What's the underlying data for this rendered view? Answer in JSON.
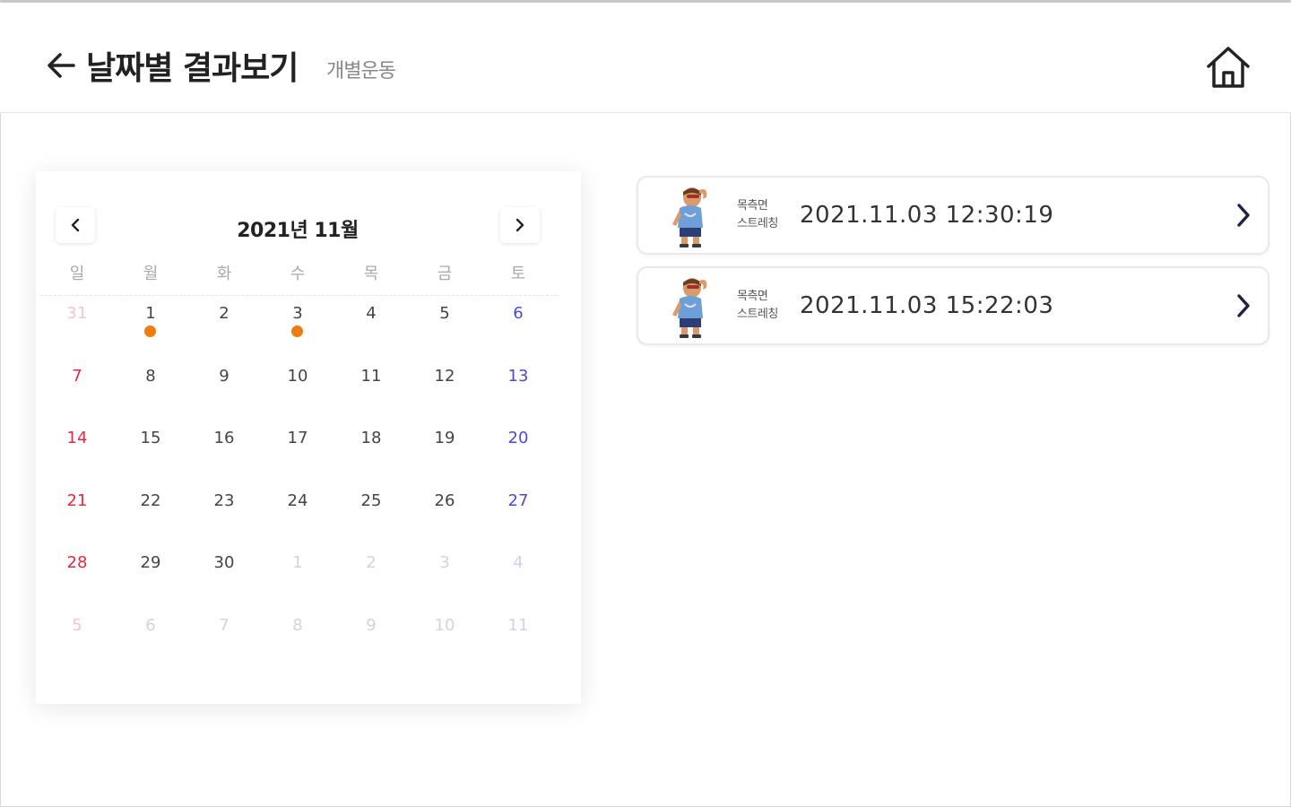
{
  "header": {
    "title": "날짜별 결과보기",
    "subtitle": "개별운동",
    "back_icon": "arrow-left-icon",
    "home_icon": "home-icon"
  },
  "calendar": {
    "month_label": "2021년 11월",
    "prev_icon": "chevron-left-icon",
    "next_icon": "chevron-right-icon",
    "weekdays": [
      "일",
      "월",
      "화",
      "수",
      "목",
      "금",
      "토"
    ],
    "days": [
      {
        "label": "31",
        "other": true,
        "dot": false
      },
      {
        "label": "1",
        "other": false,
        "dot": true
      },
      {
        "label": "2",
        "other": false,
        "dot": false
      },
      {
        "label": "3",
        "other": false,
        "dot": true
      },
      {
        "label": "4",
        "other": false,
        "dot": false
      },
      {
        "label": "5",
        "other": false,
        "dot": false
      },
      {
        "label": "6",
        "other": false,
        "dot": false
      },
      {
        "label": "7",
        "other": false,
        "dot": false
      },
      {
        "label": "8",
        "other": false,
        "dot": false
      },
      {
        "label": "9",
        "other": false,
        "dot": false
      },
      {
        "label": "10",
        "other": false,
        "dot": false
      },
      {
        "label": "11",
        "other": false,
        "dot": false
      },
      {
        "label": "12",
        "other": false,
        "dot": false
      },
      {
        "label": "13",
        "other": false,
        "dot": false
      },
      {
        "label": "14",
        "other": false,
        "dot": false
      },
      {
        "label": "15",
        "other": false,
        "dot": false
      },
      {
        "label": "16",
        "other": false,
        "dot": false
      },
      {
        "label": "17",
        "other": false,
        "dot": false
      },
      {
        "label": "18",
        "other": false,
        "dot": false
      },
      {
        "label": "19",
        "other": false,
        "dot": false
      },
      {
        "label": "20",
        "other": false,
        "dot": false
      },
      {
        "label": "21",
        "other": false,
        "dot": false
      },
      {
        "label": "22",
        "other": false,
        "dot": false
      },
      {
        "label": "23",
        "other": false,
        "dot": false
      },
      {
        "label": "24",
        "other": false,
        "dot": false
      },
      {
        "label": "25",
        "other": false,
        "dot": false
      },
      {
        "label": "26",
        "other": false,
        "dot": false
      },
      {
        "label": "27",
        "other": false,
        "dot": false
      },
      {
        "label": "28",
        "other": false,
        "dot": false
      },
      {
        "label": "29",
        "other": false,
        "dot": false
      },
      {
        "label": "30",
        "other": false,
        "dot": false
      },
      {
        "label": "1",
        "other": true,
        "dot": false
      },
      {
        "label": "2",
        "other": true,
        "dot": false
      },
      {
        "label": "3",
        "other": true,
        "dot": false
      },
      {
        "label": "4",
        "other": true,
        "dot": false
      },
      {
        "label": "5",
        "other": true,
        "dot": false
      },
      {
        "label": "6",
        "other": true,
        "dot": false
      },
      {
        "label": "7",
        "other": true,
        "dot": false
      },
      {
        "label": "8",
        "other": true,
        "dot": false
      },
      {
        "label": "9",
        "other": true,
        "dot": false
      },
      {
        "label": "10",
        "other": true,
        "dot": false
      },
      {
        "label": "11",
        "other": true,
        "dot": false
      }
    ]
  },
  "records": [
    {
      "name_line1": "목측면",
      "name_line2": "스트레칭",
      "datetime": "2021.11.03  12:30:19",
      "avatar_icon": "stretching-avatar-icon",
      "chevron_icon": "chevron-right-icon"
    },
    {
      "name_line1": "목측면",
      "name_line2": "스트레칭",
      "datetime": "2021.11.03  15:22:03",
      "avatar_icon": "stretching-avatar-icon",
      "chevron_icon": "chevron-right-icon"
    }
  ],
  "colors": {
    "sunday": "#e8273c",
    "saturday": "#4a4ad8",
    "event_dot": "#f07c0c",
    "text": "#222222"
  }
}
